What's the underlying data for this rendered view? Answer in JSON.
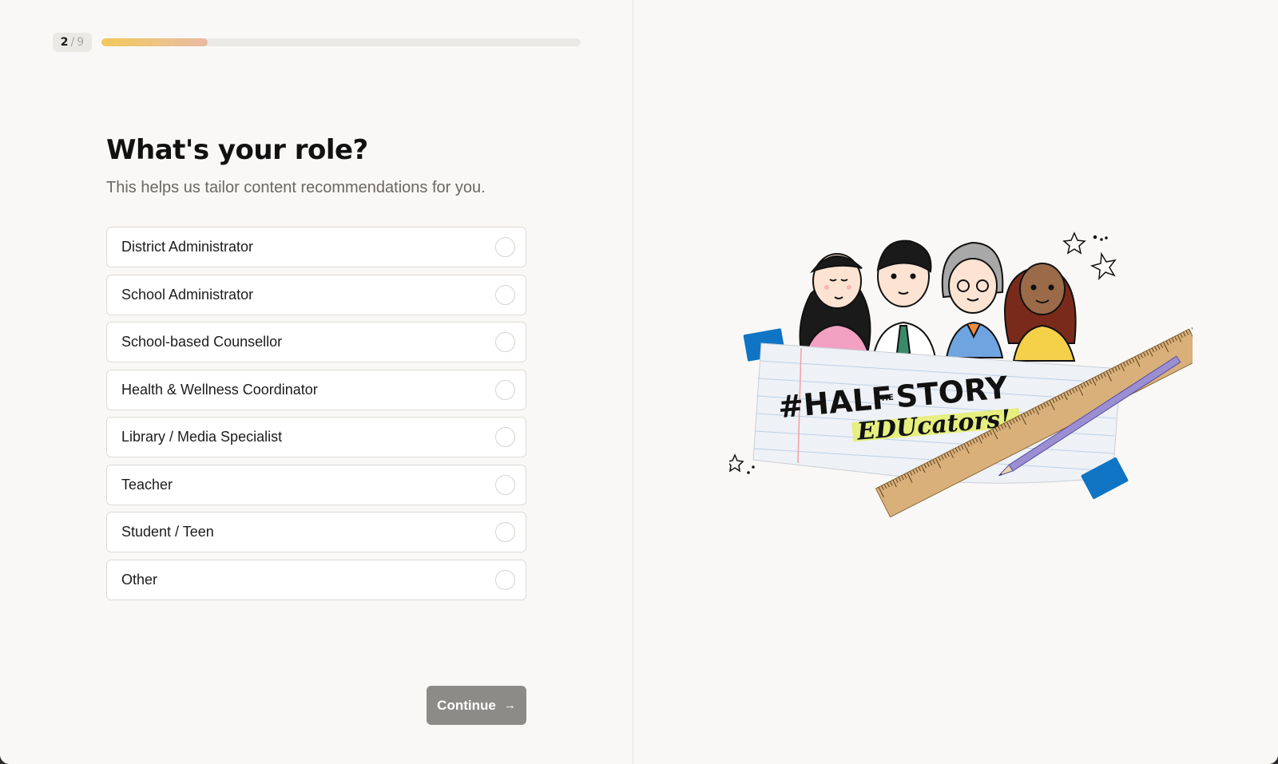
{
  "progress": {
    "current": "2",
    "separator": "/",
    "total": "9",
    "fraction": 0.222
  },
  "question": {
    "title": "What's your role?",
    "subtitle": "This helps us tailor content recommendations for you."
  },
  "options": [
    {
      "label": "District Administrator"
    },
    {
      "label": "School Administrator"
    },
    {
      "label": "School-based Counsellor"
    },
    {
      "label": "Health & Wellness Coordinator"
    },
    {
      "label": "Library / Media Specialist"
    },
    {
      "label": "Teacher"
    },
    {
      "label": "Student / Teen"
    },
    {
      "label": "Other"
    }
  ],
  "continue_button": {
    "label": "Continue",
    "icon": "arrow-right-icon"
  },
  "illustration": {
    "line1": "#HALF",
    "line1_small": "THE",
    "line1_end": "STORY",
    "line2": "EDUcators!"
  },
  "colors": {
    "progress_start": "#f1c95a",
    "progress_end": "#e9b9a2",
    "button_disabled": "#8d8b88",
    "tape": "#0f74c4",
    "pencil": "#9b8fd4",
    "ruler": "#d9b07a"
  }
}
